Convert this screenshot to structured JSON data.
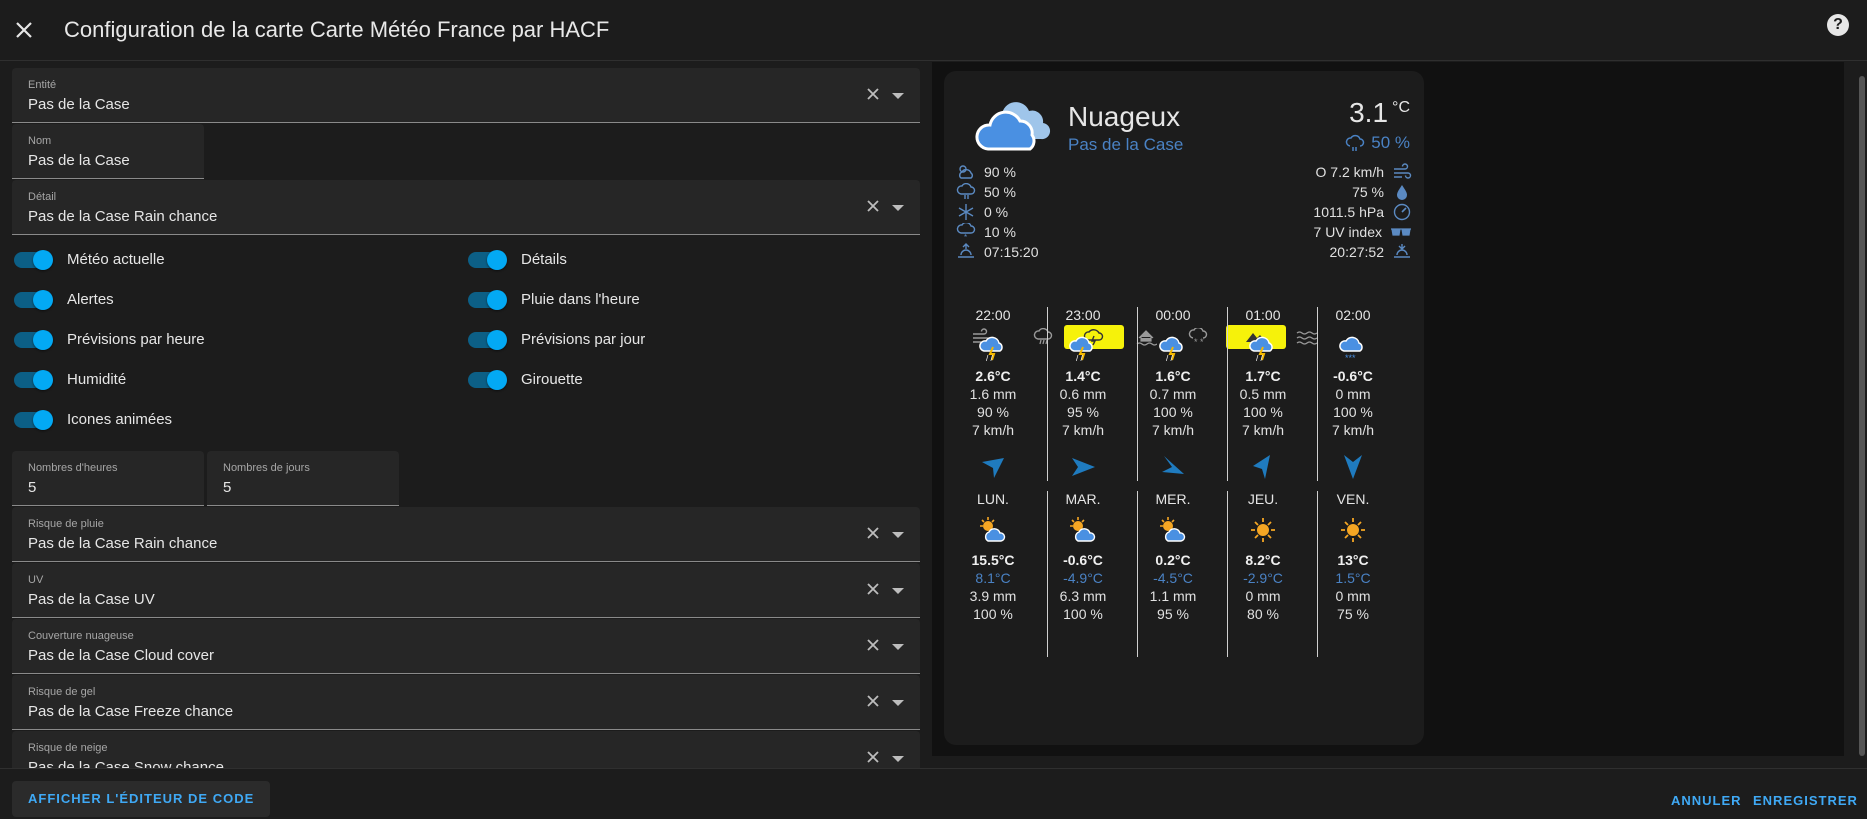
{
  "dialog": {
    "title": "Configuration de la carte Carte Météo France par HACF",
    "help_icon": "?"
  },
  "fields": {
    "entite": {
      "label": "Entité",
      "value": "Pas de la Case"
    },
    "nom": {
      "label": "Nom",
      "value": "Pas de la Case"
    },
    "detail": {
      "label": "Détail",
      "value": "Pas de la Case Rain chance"
    },
    "nombres_heures": {
      "label": "Nombres d'heures",
      "value": "5"
    },
    "nombres_jours": {
      "label": "Nombres de jours",
      "value": "5"
    },
    "risque_pluie": {
      "label": "Risque de pluie",
      "value": "Pas de la Case Rain chance"
    },
    "uv": {
      "label": "UV",
      "value": "Pas de la Case UV"
    },
    "couverture": {
      "label": "Couverture nuageuse",
      "value": "Pas de la Case Cloud cover"
    },
    "gel": {
      "label": "Risque de gel",
      "value": "Pas de la Case Freeze chance"
    },
    "neige": {
      "label": "Risque de neige",
      "value": "Pas de la Case Snow chance"
    }
  },
  "toggles": {
    "meteo_actuelle": "Météo actuelle",
    "alertes": "Alertes",
    "previsions_heure": "Prévisions par heure",
    "humidite": "Humidité",
    "icones_animees": "Icones animées",
    "details": "Détails",
    "pluie_heure": "Pluie dans l'heure",
    "previsions_jour": "Prévisions par jour",
    "girouette": "Girouette"
  },
  "footer": {
    "code_editor": "AFFICHER L'ÉDITEUR DE CODE",
    "cancel": "ANNULER",
    "save": "ENREGISTRER"
  },
  "card": {
    "condition": "Nuageux",
    "location": "Pas de la Case",
    "temperature": "3.1",
    "temp_unit": "°C",
    "precip_chance": "50 %",
    "details_left": [
      "90 %",
      "50 %",
      "0 %",
      "10 %",
      "07:15:20"
    ],
    "details_right": [
      "O 7.2 km/h",
      "75 %",
      "1011.5 hPa",
      "7 UV index",
      "20:27:52"
    ],
    "hourly": [
      {
        "time": "22:00",
        "temp": "2.6°C",
        "rain": "1.6 mm",
        "chance": "90 %",
        "wind": "7 km/h"
      },
      {
        "time": "23:00",
        "temp": "1.4°C",
        "rain": "0.6 mm",
        "chance": "95 %",
        "wind": "7 km/h"
      },
      {
        "time": "00:00",
        "temp": "1.6°C",
        "rain": "0.7 mm",
        "chance": "100 %",
        "wind": "7 km/h"
      },
      {
        "time": "01:00",
        "temp": "1.7°C",
        "rain": "0.5 mm",
        "chance": "100 %",
        "wind": "7 km/h"
      },
      {
        "time": "02:00",
        "temp": "-0.6°C",
        "rain": "0 mm",
        "chance": "100 %",
        "wind": "7 km/h"
      }
    ],
    "daily": [
      {
        "day": "LUN.",
        "high": "15.5°C",
        "low": "8.1°C",
        "rain": "3.9 mm",
        "chance": "100 %"
      },
      {
        "day": "MAR.",
        "high": "-0.6°C",
        "low": "-4.9°C",
        "rain": "6.3 mm",
        "chance": "100 %"
      },
      {
        "day": "MER.",
        "high": "0.2°C",
        "low": "-4.5°C",
        "rain": "1.1 mm",
        "chance": "95 %"
      },
      {
        "day": "JEU.",
        "high": "8.2°C",
        "low": "-2.9°C",
        "rain": "0 mm",
        "chance": "80 %"
      },
      {
        "day": "VEN.",
        "high": "13°C",
        "low": "1.5°C",
        "rain": "0 mm",
        "chance": "75 %"
      }
    ]
  },
  "colors": {
    "accent": "#03a9f4",
    "link": "#3fa9f5",
    "highlight": "#f6f20a",
    "location_blue": "#4a82c4"
  }
}
